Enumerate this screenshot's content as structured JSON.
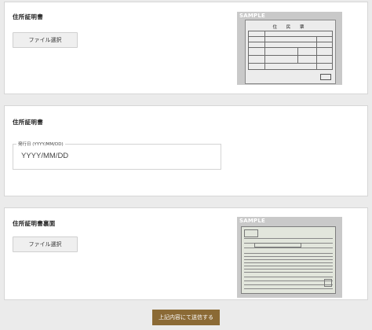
{
  "sections": [
    {
      "label": "住所証明書",
      "button_label": "ファイル選択",
      "sample_tag": "SAMPLE",
      "sample_doc_title": "住 民 票"
    },
    {
      "label": "住所証明書",
      "date_caption": "発行日 (YYYY/MM/DD)",
      "date_placeholder": "YYYY/MM/DD"
    },
    {
      "label": "住所証明書裏面",
      "button_label": "ファイル選択",
      "sample_tag": "SAMPLE"
    }
  ],
  "submit_label": "上記内容にて送信する",
  "colors": {
    "background": "#ebebeb",
    "panel": "#ffffff",
    "submit": "#8b6a35"
  }
}
